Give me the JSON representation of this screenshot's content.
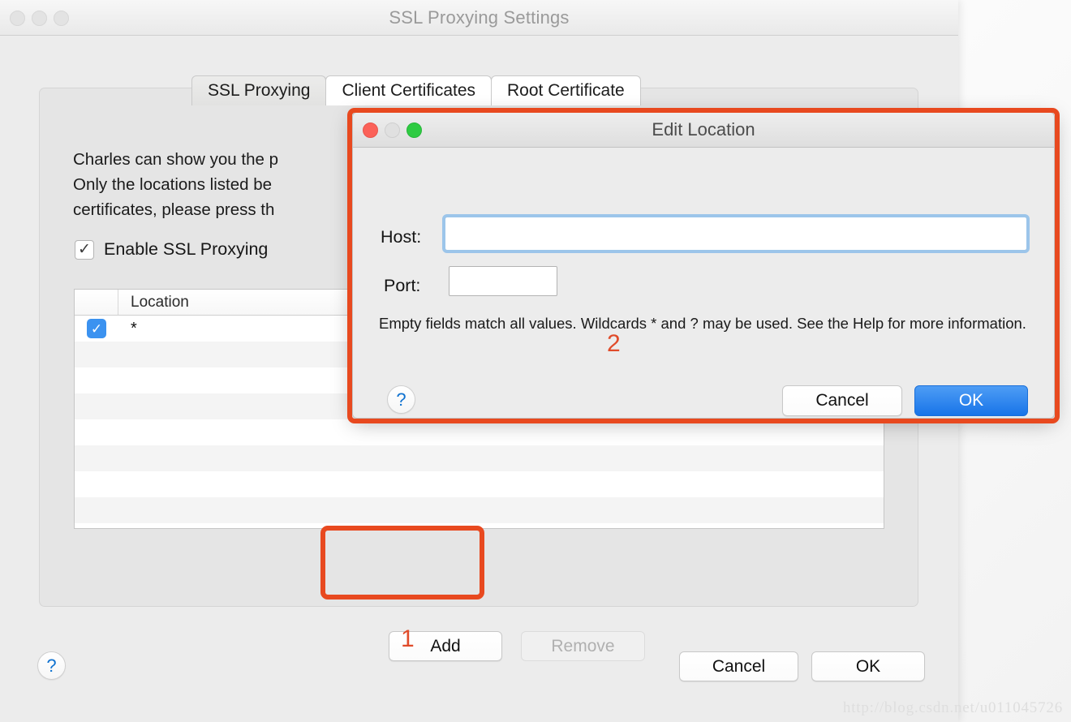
{
  "main_window": {
    "title": "SSL Proxying Settings",
    "traffic_lights": [
      "close-inactive",
      "minimize-inactive",
      "zoom-inactive"
    ],
    "tabs": [
      {
        "label": "SSL Proxying",
        "selected": true
      },
      {
        "label": "Client Certificates",
        "selected": false
      },
      {
        "label": "Root Certificate",
        "selected": false
      }
    ],
    "intro_lines": [
      "Charles can show you the p",
      "Only the locations listed be",
      "certificates, please press th"
    ],
    "enable_checkbox": {
      "label": "Enable SSL Proxying",
      "checked": true,
      "glyph": "✓"
    },
    "table": {
      "columns": [
        "",
        "Location"
      ],
      "rows": [
        {
          "checked": true,
          "location": "*"
        }
      ],
      "empty_row_count": 8
    },
    "list_buttons": {
      "add_label": "Add",
      "remove_label": "Remove",
      "remove_enabled": false
    },
    "footer": {
      "help_glyph": "?",
      "cancel_label": "Cancel",
      "ok_label": "OK"
    }
  },
  "dialog": {
    "title": "Edit Location",
    "traffic_lights": [
      "close-active",
      "minimize-disabled",
      "zoom-active"
    ],
    "host": {
      "label": "Host:",
      "value": "",
      "placeholder": "",
      "focused": true
    },
    "port": {
      "label": "Port:",
      "value": "",
      "placeholder": ""
    },
    "hint": "Empty fields match all values. Wildcards * and ? may be used. See the Help for more information.",
    "help_glyph": "?",
    "cancel_label": "Cancel",
    "ok_label": "OK"
  },
  "annotations": {
    "step_one": "1",
    "step_two": "2",
    "color": "#e8491f"
  },
  "watermark": "http://blog.csdn.net/u011045726",
  "colors": {
    "accent_blue": "#1874e8",
    "checkbox_blue": "#3b92f0",
    "annotation_red": "#e8491f",
    "window_bg": "#ececec",
    "panel_bg": "#e5e5e5"
  }
}
